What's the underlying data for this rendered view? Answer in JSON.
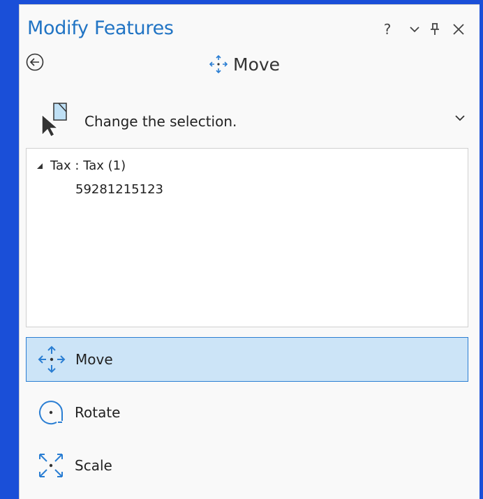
{
  "pane": {
    "title": "Modify Features",
    "controls": {
      "help": "?"
    }
  },
  "tool": {
    "name": "Move"
  },
  "selection": {
    "instruction": "Change the selection."
  },
  "tree": {
    "layer": "Tax : Tax (1)",
    "feature": "59281215123"
  },
  "tools": [
    {
      "label": "Move",
      "active": true
    },
    {
      "label": "Rotate",
      "active": false
    },
    {
      "label": "Scale",
      "active": false
    }
  ],
  "colors": {
    "accent": "#2174c4",
    "active_bg": "#cce4f7",
    "active_border": "#2a7ed3",
    "icon": "#2a7ed3"
  }
}
